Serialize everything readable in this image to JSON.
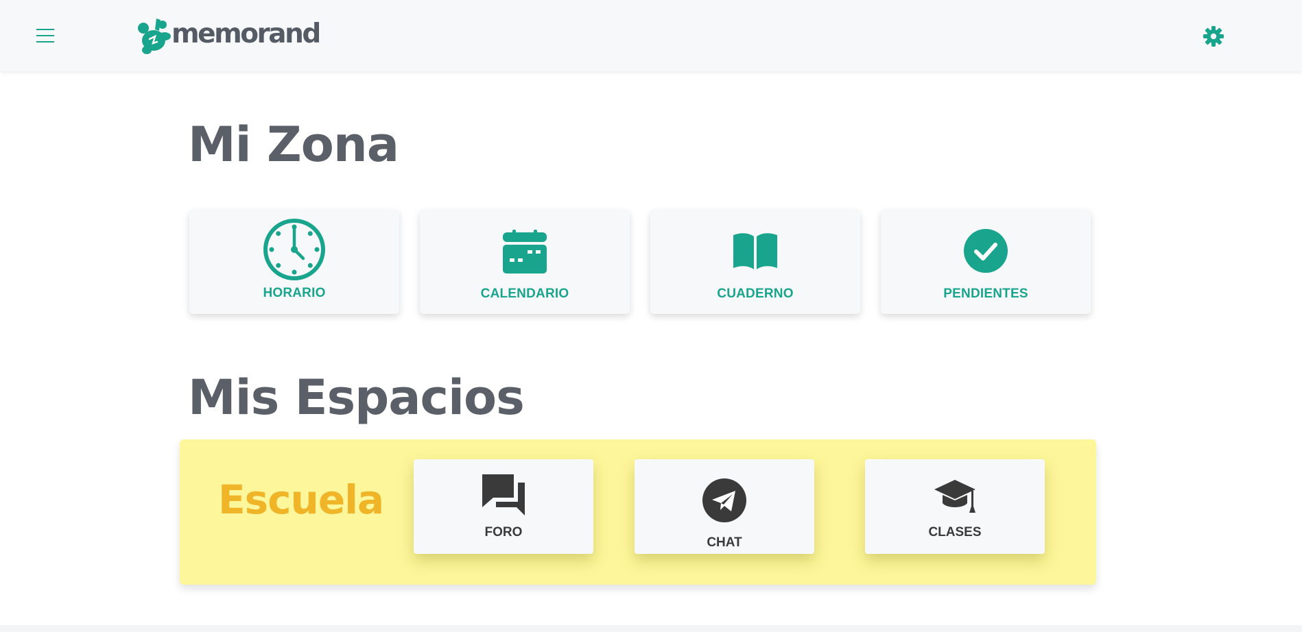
{
  "header": {
    "brand": "memorand",
    "menu_icon": "hamburger-menu-icon",
    "settings_icon": "gear-icon",
    "accent_color": "#19a48d"
  },
  "mi_zona": {
    "title": "Mi Zona",
    "cards": [
      {
        "label": "HORARIO",
        "icon": "clock-icon"
      },
      {
        "label": "CALENDARIO",
        "icon": "calendar-icon"
      },
      {
        "label": "CUADERNO",
        "icon": "book-icon"
      },
      {
        "label": "PENDIENTES",
        "icon": "check-circle-icon"
      }
    ]
  },
  "mis_espacios": {
    "title": "Mis Espacios",
    "spaces": [
      {
        "name": "Escuela",
        "background_color": "#fdf69a",
        "name_color": "#f0b429",
        "items": [
          {
            "label": "FORO",
            "icon": "forum-icon"
          },
          {
            "label": "CHAT",
            "icon": "telegram-icon"
          },
          {
            "label": "CLASES",
            "icon": "graduation-cap-icon"
          }
        ]
      }
    ]
  }
}
